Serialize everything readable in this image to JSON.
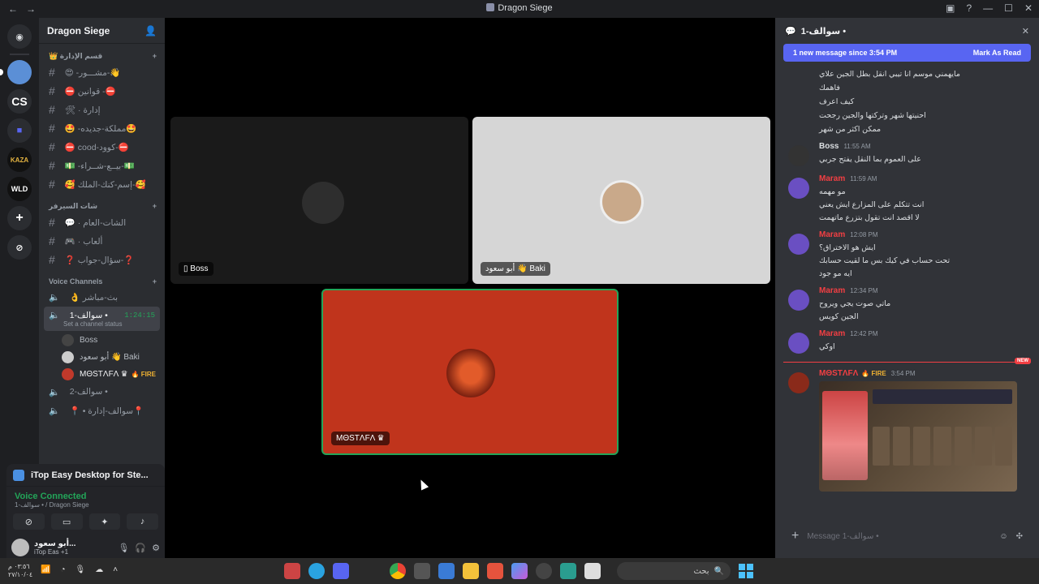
{
  "window": {
    "title": "Dragon Siege",
    "back": "←",
    "forward": "→"
  },
  "guilds": [
    {
      "name": "discord-home",
      "label": "",
      "color": "#2b2d31"
    },
    {
      "name": "server-a",
      "label": "",
      "color": "#5b8fd6"
    },
    {
      "name": "server-cs",
      "label": "CS",
      "color": "#2b2d31"
    },
    {
      "name": "server-folder",
      "label": "",
      "color": "#2b2d31"
    },
    {
      "name": "server-kaza",
      "label": "KAZA",
      "color": "#111"
    },
    {
      "name": "server-wld",
      "label": "WLD",
      "color": "#111"
    }
  ],
  "server": {
    "name": "Dragon Siege"
  },
  "categories": [
    {
      "label": "👑 قسم الإدارة",
      "channels": [
        "😍 -مشـــور-👋",
        "⛔ قوانين -⛔",
        "🛠 · إدارة",
        "🤩 -مملكة-جديده🤩",
        "⛔ cood-كوود-⛔",
        "💵 -بيــع-شــراء-💵",
        "🥰 إسم-كنك-الملك-🥰"
      ]
    },
    {
      "label": "شات السيرفر",
      "channels": [
        "💬 · الشات-العام",
        "🎮 · ألعاب",
        "❓ سؤال-جواب-❓"
      ]
    }
  ],
  "voice": {
    "label": "Voice Channels",
    "channels": [
      {
        "name": "👌 بث-مباشر",
        "active": false
      },
      {
        "name": "سوالف-1 •",
        "active": true,
        "timer": "1:24:15",
        "status": "Set a channel status"
      },
      {
        "name": "سوالف-2 •",
        "active": false
      },
      {
        "name": "📍 • سوالف-إدارة📍",
        "active": false
      }
    ],
    "users": [
      {
        "name": "Boss",
        "badge": "",
        "color": "#555"
      },
      {
        "name": "أبو سعود 👋 Baki",
        "badge": "",
        "color": "#ccc"
      },
      {
        "name": "MΘSTΛFΛ ♛",
        "badge": "🔥 FIRE",
        "color": "#c0392b"
      }
    ]
  },
  "app_share": {
    "label": "iTop Easy Desktop for Ste..."
  },
  "voice_status": {
    "label": "Voice Connected",
    "sub": "سوالف-1 • / Dragon Siege"
  },
  "user": {
    "name": "أبو سعود...",
    "status": "iTop Eas +1"
  },
  "tiles": [
    {
      "label": "Boss",
      "bg": "#1a1a1a"
    },
    {
      "label": "أبو سعود 👋 Baki",
      "bg": "#d6d6d6"
    },
    {
      "label": "MΘSTΛFΛ ♛",
      "bg": "#c0341c"
    }
  ],
  "chat": {
    "channel": "سوالف-1 •",
    "banner_text": "1 new message since 3:54 PM",
    "banner_action": "Mark As Read",
    "top_lines": [
      "مايهمني موسم انا تيبي انقل بطل الجين علاي",
      "فاهمك",
      "كيف اعرف",
      "احنيتها شهر وتركتها والجين رجحت",
      "ممكن اكثر من شهر"
    ],
    "messages": [
      {
        "author": "Boss",
        "time": "11:55 AM",
        "color": "#dbdee1",
        "lines": [
          "على العموم بما النقل يفتح جربي"
        ]
      },
      {
        "author": "Maram",
        "time": "11:59 AM",
        "color": "#f23f43",
        "lines": [
          "مو مهمه",
          "انت تتكلم على المزارع ايش يعني",
          "لا اقصد انت تقول بتزرع ماتهمت"
        ]
      },
      {
        "author": "Maram",
        "time": "12:08 PM",
        "color": "#f23f43",
        "lines": [
          "ايش هو الاختراق؟",
          "تحت حساب في كيك بس ما لقيت حسابك",
          "ايه مو جود"
        ]
      },
      {
        "author": "Maram",
        "time": "12:34 PM",
        "color": "#f23f43",
        "lines": [
          "ماتي صوت يجي ويروح",
          "الجين كويس"
        ]
      },
      {
        "author": "Maram",
        "time": "12:42 PM",
        "color": "#f23f43",
        "lines": [
          "اوكي"
        ]
      }
    ],
    "new_label": "NEW",
    "last": {
      "author": "MΘSTΛFΛ",
      "badge": "🔥 FIRE",
      "time": "3:54 PM"
    },
    "placeholder": "Message سوالف-1 •"
  },
  "taskbar": {
    "clock": "٠٣:٥٦ م",
    "date": "٢٧/١٠/٠٤",
    "search": "بحث"
  }
}
